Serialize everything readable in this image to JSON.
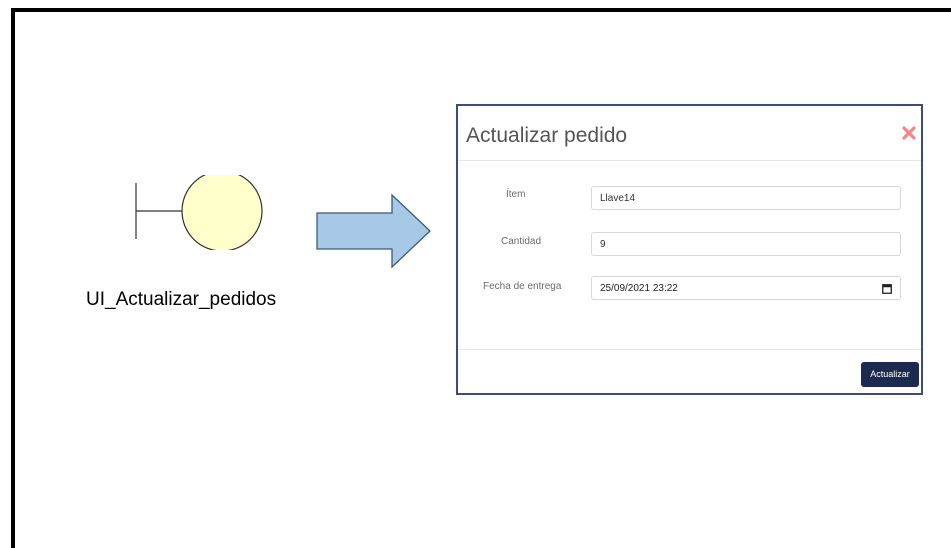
{
  "diagram": {
    "boundary_label": "UI_Actualizar_pedidos",
    "boundary_fill": "#ffffcc"
  },
  "modal": {
    "title": "Actualizar pedido",
    "close_icon": "close-icon",
    "fields": {
      "item": {
        "label": "Ítem",
        "value": "Llave14"
      },
      "quantity": {
        "label": "Cantidad",
        "value": "9"
      },
      "delivery_date": {
        "label": "Fecha de entrega",
        "value": "25/09/2021 23:22",
        "icon": "calendar-icon"
      }
    },
    "submit_label": "Actualizar"
  },
  "colors": {
    "arrow_fill": "#a8c8e8",
    "arrow_stroke": "#3a5a7a",
    "modal_border": "#3a4f78",
    "button_bg": "#1c2a4f",
    "close_icon": "#f08888"
  }
}
